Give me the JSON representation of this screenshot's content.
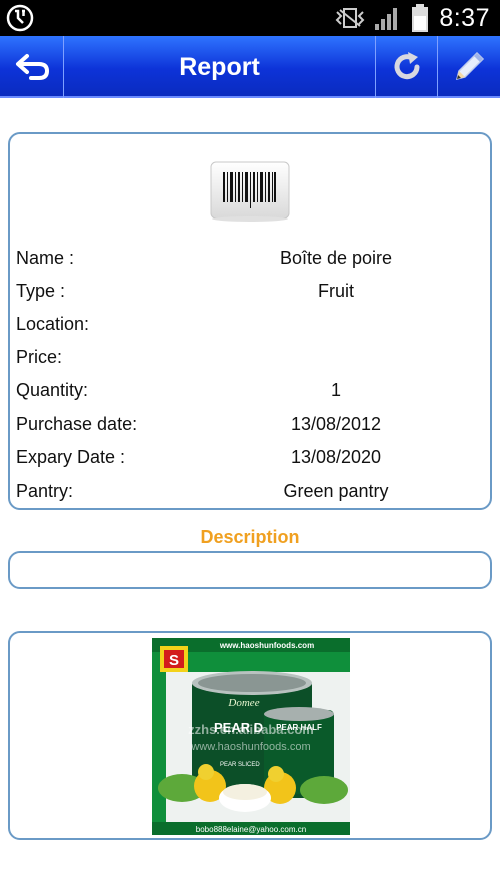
{
  "status_bar": {
    "time": "8:37",
    "icons": [
      "usb-debug-icon",
      "vibrate-icon",
      "signal-icon",
      "battery-icon"
    ]
  },
  "action_bar": {
    "title": "Report",
    "back_icon": "back-arrow-icon",
    "refresh_icon": "refresh-icon",
    "edit_icon": "pencil-icon"
  },
  "details": {
    "rows": [
      {
        "label": "Name :",
        "value": "Boîte de poire"
      },
      {
        "label": "Type :",
        "value": "Fruit"
      },
      {
        "label": "Location:",
        "value": ""
      },
      {
        "label": "Price:",
        "value": ""
      },
      {
        "label": "Quantity:",
        "value": "1"
      },
      {
        "label": "Purchase date:",
        "value": "13/08/2012"
      },
      {
        "label": "Expary Date :",
        "value": "13/08/2020"
      },
      {
        "label": "Pantry:",
        "value": "Green pantry"
      }
    ]
  },
  "description": {
    "title": "Description",
    "text": ""
  },
  "product_image": {
    "top_url": "www.haoshunfoods.com",
    "brand": "Domee",
    "can_text_big": "PEAR DICE",
    "can_text_small": "PEAR HALF",
    "watermark_1": "zzhs.en.alibaba.com",
    "watermark_2": "www.haoshunfoods.com",
    "can_subtext": "PEAR SLICED",
    "email": "bobo888elaine@yahoo.com.cn"
  },
  "colors": {
    "action_bar": "#0d33d8",
    "card_border": "#6a9ac6",
    "description_title": "#f0a020"
  }
}
